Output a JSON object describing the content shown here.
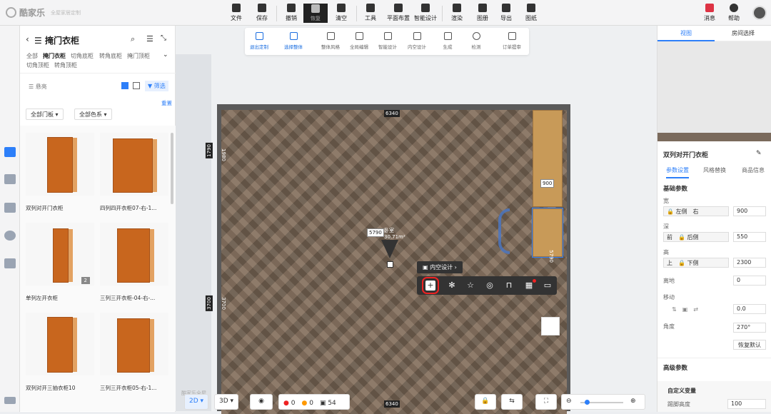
{
  "app": {
    "logo": "酷家乐",
    "tagline": "全屋家居定制"
  },
  "toolbar": [
    {
      "label": "文件",
      "icon": "file-icon"
    },
    {
      "label": "保存",
      "icon": "save-icon"
    },
    {
      "label": "撤销",
      "icon": "undo-icon"
    },
    {
      "label": "恢复",
      "icon": "redo-icon"
    },
    {
      "label": "清空",
      "icon": "eraser-icon"
    },
    {
      "label": "工具",
      "icon": "wrench-icon"
    },
    {
      "label": "平面布置",
      "icon": "layout-icon"
    },
    {
      "label": "智能设计",
      "icon": "bolt-icon"
    },
    {
      "label": "渲染",
      "icon": "render-icon"
    },
    {
      "label": "图册",
      "icon": "album-icon"
    },
    {
      "label": "导出",
      "icon": "export-icon"
    },
    {
      "label": "图纸",
      "icon": "drawing-icon"
    }
  ],
  "top_right": {
    "messages": "消息",
    "help": "帮助"
  },
  "subtoolbar": [
    "退出定制",
    "选择整体",
    "整体风格",
    "全局编辑",
    "智能设计",
    "内空设计",
    "生成",
    "检测",
    "订单提审"
  ],
  "left_panel": {
    "title": "掩门衣柜",
    "categories": [
      "全部",
      "掩门衣柜",
      "切角底柜",
      "转角底柜",
      "掩门顶柜",
      "切角顶柜",
      "转角顶柜"
    ],
    "view_mode": "悬亮",
    "filter": "筛选",
    "reset": "重置",
    "door_filter": "全部门板",
    "color_filter": "全部色系",
    "products": [
      {
        "name": "双列对开门衣柜"
      },
      {
        "name": "四列四开衣柜07-右-1..."
      },
      {
        "name": "单列左开衣柜",
        "badge": "2"
      },
      {
        "name": "三列三开衣柜-04-右-..."
      },
      {
        "name": "双列对开三抽衣柜10"
      },
      {
        "name": "三列三开衣柜05-右-1..."
      }
    ]
  },
  "canvas": {
    "dims": {
      "top": "6340",
      "bottom": "6340",
      "left_top": "1790",
      "left_bottom": "3700",
      "inner_left_top": "1980",
      "inner_left_bottom": "3700",
      "center": "5790",
      "selection_w": "900",
      "right": "5790"
    },
    "area": "30.71m²",
    "room": "卧室",
    "context_label": "内空设计",
    "watermark": "酷家乐全屋"
  },
  "right_panel": {
    "tabs": [
      "视图",
      "房间选择"
    ],
    "object": "双列对开门衣柜",
    "subtabs": [
      "参数设置",
      "风格替换",
      "商品信息"
    ],
    "basic": "基础参数",
    "width": {
      "label": "宽",
      "opts": [
        "左侧",
        "右"
      ],
      "value": "900"
    },
    "depth": {
      "label": "深",
      "opts": [
        "前",
        "后侧"
      ],
      "value": "550"
    },
    "height": {
      "label": "高",
      "opts": [
        "上",
        "下侧"
      ],
      "value": "2300"
    },
    "ground": {
      "label": "离地",
      "value": "0"
    },
    "move": {
      "label": "移动",
      "value": "0.0"
    },
    "angle": {
      "label": "角度",
      "value": "270°"
    },
    "reset": "恢复默认",
    "advanced": "高级参数",
    "custom_var": "自定义变量",
    "kick_height": {
      "label": "踢脚高度",
      "value": "100"
    }
  },
  "bottom": {
    "mode2d": "2D",
    "mode3d": "3D",
    "errors": "0",
    "warnings": "0",
    "count": "54"
  }
}
